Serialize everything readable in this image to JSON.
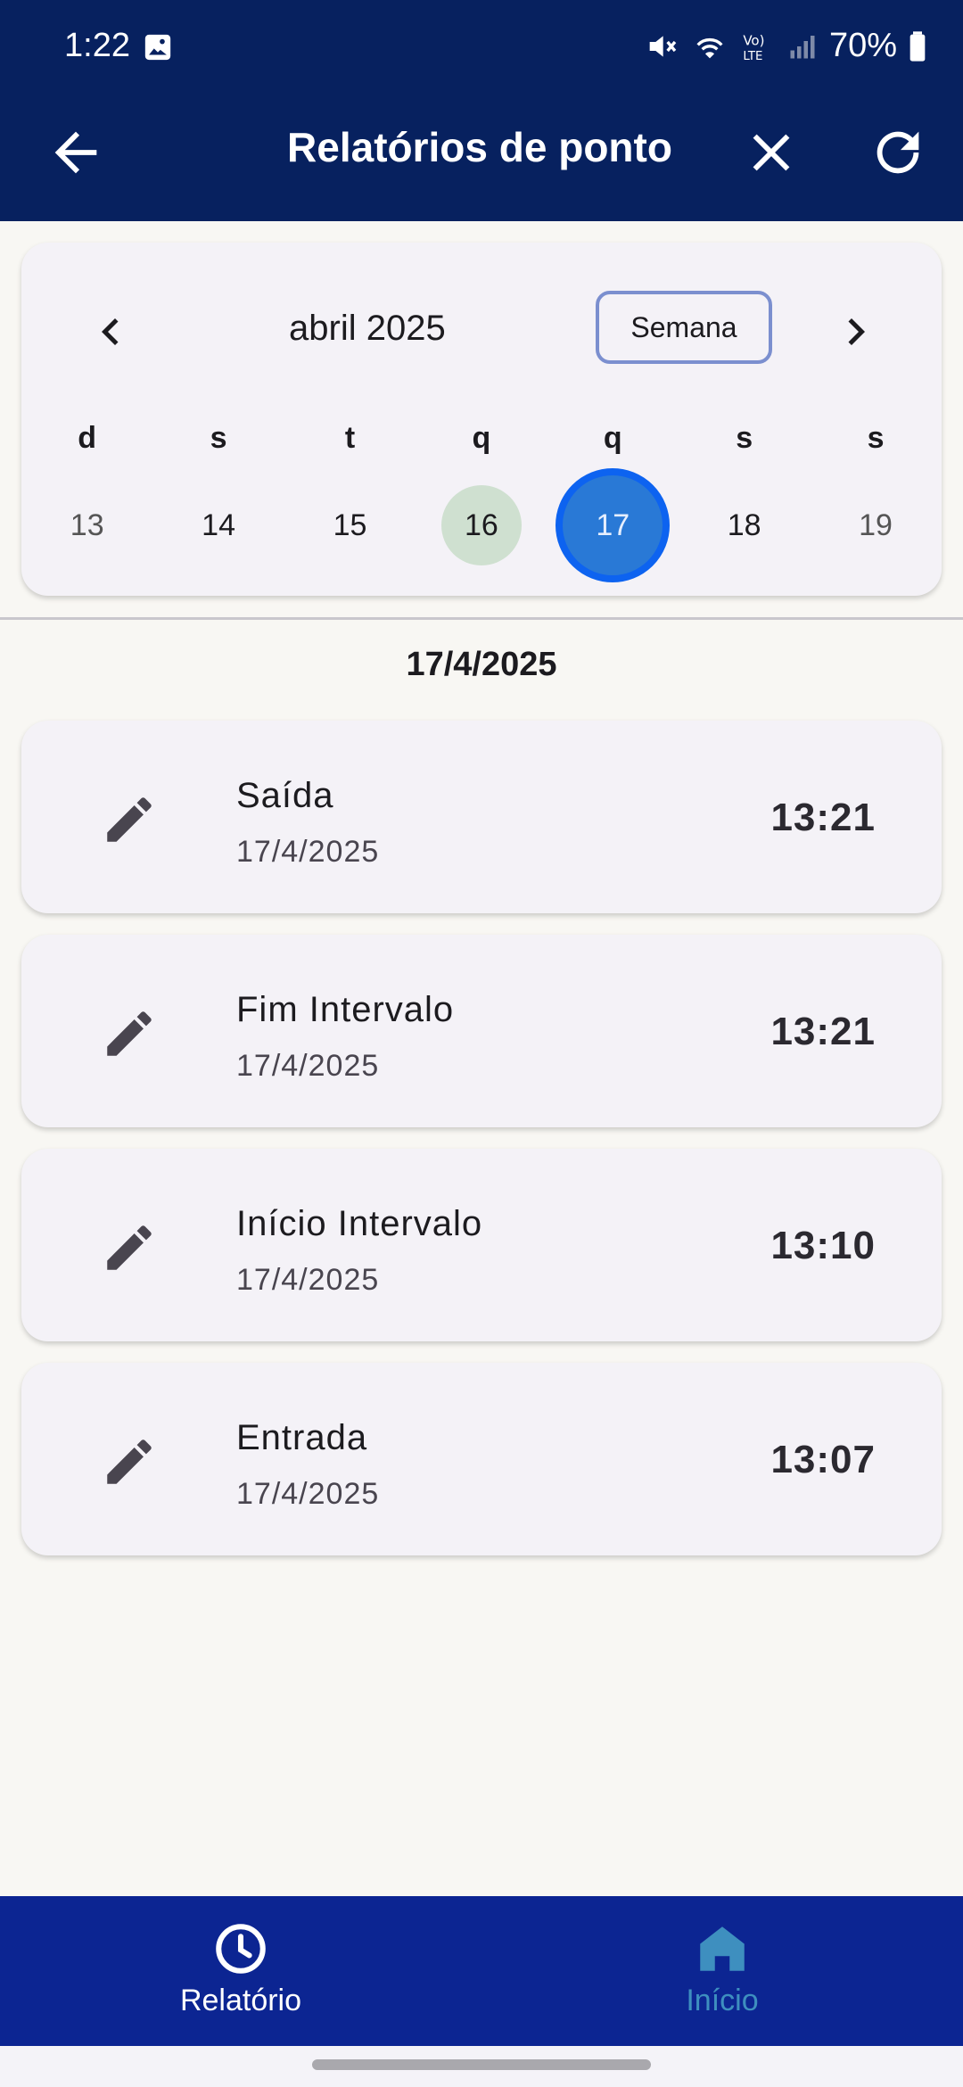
{
  "status_bar": {
    "time": "1:22",
    "battery": "70%",
    "icons": [
      "image-icon",
      "mute-icon",
      "wifi-icon",
      "volte-icon",
      "signal-icon",
      "battery-icon"
    ]
  },
  "header": {
    "title": "Relatórios de ponto",
    "icons": [
      "arrow-back-icon",
      "close-icon",
      "refresh-icon"
    ],
    "background": "#07215f"
  },
  "calendar": {
    "month_label": "abril 2025",
    "view_mode": "Semana",
    "weekdays": [
      "d",
      "s",
      "t",
      "q",
      "q",
      "s",
      "s"
    ],
    "days": [
      "13",
      "14",
      "15",
      "16",
      "17",
      "18",
      "19"
    ],
    "today": "16",
    "selected": "17",
    "selected_color": "#2979d6",
    "today_color": "#cfe0d0"
  },
  "date_heading": "17/4/2025",
  "entries": [
    {
      "label": "Saída",
      "date": "17/4/2025",
      "time": "13:21",
      "icon": "edit-icon"
    },
    {
      "label": "Fim Intervalo",
      "date": "17/4/2025",
      "time": "13:21",
      "icon": "edit-icon"
    },
    {
      "label": "Início Intervalo",
      "date": "17/4/2025",
      "time": "13:10",
      "icon": "edit-icon"
    },
    {
      "label": "Entrada",
      "date": "17/4/2025",
      "time": "13:07",
      "icon": "edit-icon"
    }
  ],
  "bottom_nav": {
    "items": [
      {
        "label": "Relatório",
        "icon": "clock-icon",
        "color": "#ffffff"
      },
      {
        "label": "Início",
        "icon": "home-icon",
        "color": "#3e8fbf"
      }
    ],
    "background": "#0c2592"
  }
}
